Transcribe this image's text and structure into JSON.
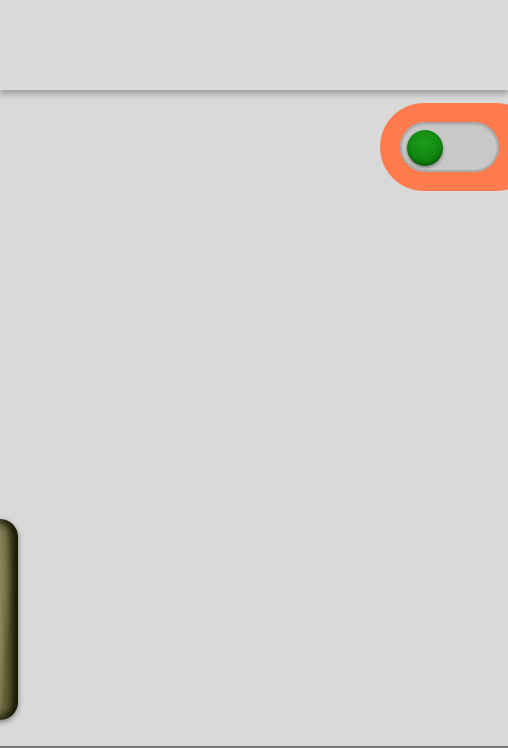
{
  "header": {
    "title": ""
  },
  "toggle": {
    "state": "off",
    "knob_color": "#108a10",
    "highlight_color": "#ff7a4d",
    "track_color": "#c8c8c8"
  },
  "background_color": "#d9d9d9",
  "image_card": {
    "icon": "photo-thumbnail"
  }
}
